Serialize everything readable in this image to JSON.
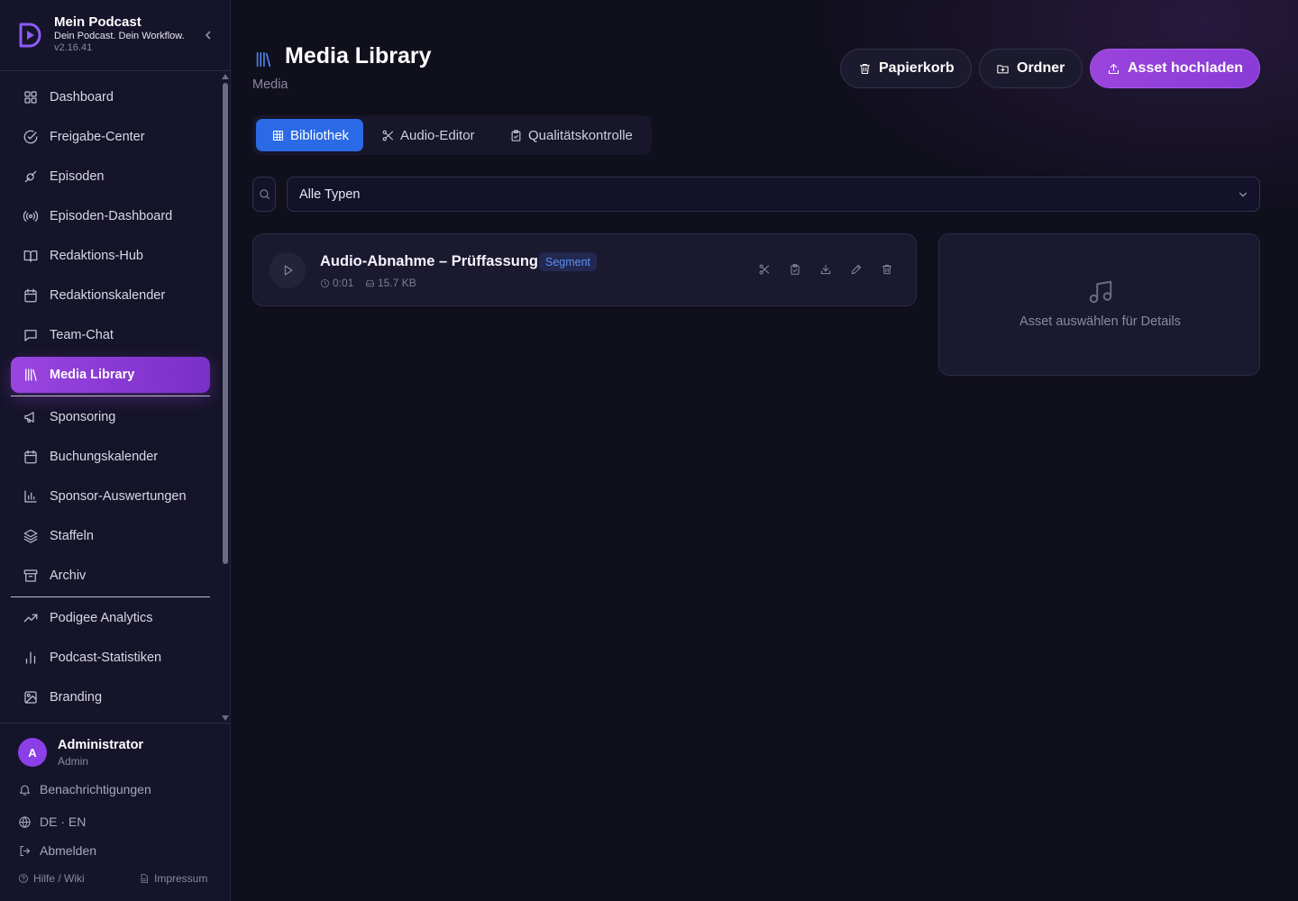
{
  "brand": {
    "name": "Mein Podcast",
    "tagline": "Dein Podcast. Dein Workflow.",
    "version": "v2.16.41"
  },
  "nav": {
    "items": [
      {
        "label": "Dashboard",
        "icon": "grid-icon"
      },
      {
        "label": "Freigabe-Center",
        "icon": "check-circle-icon"
      },
      {
        "label": "Episoden",
        "icon": "link-icon"
      },
      {
        "label": "Episoden-Dashboard",
        "icon": "broadcast-icon"
      },
      {
        "label": "Redaktions-Hub",
        "icon": "book-open-icon"
      },
      {
        "label": "Redaktionskalender",
        "icon": "calendar-icon"
      },
      {
        "label": "Team-Chat",
        "icon": "message-icon"
      },
      {
        "label": "Media Library",
        "icon": "library-icon",
        "active": true
      },
      {
        "label": "Sponsoring",
        "icon": "megaphone-icon"
      },
      {
        "label": "Buchungskalender",
        "icon": "calendar-icon"
      },
      {
        "label": "Sponsor-Auswertungen",
        "icon": "bar-chart-icon"
      },
      {
        "label": "Staffeln",
        "icon": "layers-icon"
      },
      {
        "label": "Archiv",
        "icon": "archive-icon"
      },
      {
        "label": "Podigee Analytics",
        "icon": "trending-up-icon"
      },
      {
        "label": "Podcast-Statistiken",
        "icon": "bar-chart-2-icon"
      },
      {
        "label": "Branding",
        "icon": "image-icon"
      }
    ]
  },
  "user": {
    "initial": "A",
    "name": "Administrator",
    "role": "Admin"
  },
  "footer": {
    "notifications": "Benachrichtigungen",
    "language": "DE · EN",
    "logout": "Abmelden",
    "help": "Hilfe / Wiki",
    "imprint": "Impressum"
  },
  "header": {
    "title": "Media Library",
    "subtitle": "Media",
    "buttons": {
      "trash": "Papierkorb",
      "folder": "Ordner",
      "upload": "Asset hochladen"
    }
  },
  "tabs": [
    {
      "label": "Bibliothek",
      "active": true
    },
    {
      "label": "Audio-Editor"
    },
    {
      "label": "Qualitätskontrolle"
    }
  ],
  "filter": {
    "type_select": "Alle Typen"
  },
  "assets": [
    {
      "title": "Audio-Abnahme – Prüffassung",
      "badge": "Segment",
      "duration": "0:01",
      "size": "15.7 KB"
    }
  ],
  "detail": {
    "empty_text": "Asset auswählen für Details"
  },
  "colors": {
    "accent_purple": "#9b45e0",
    "tab_active_blue": "#2b6ae6",
    "page_icon_blue": "#4d86f0",
    "background": "#100f1c"
  }
}
